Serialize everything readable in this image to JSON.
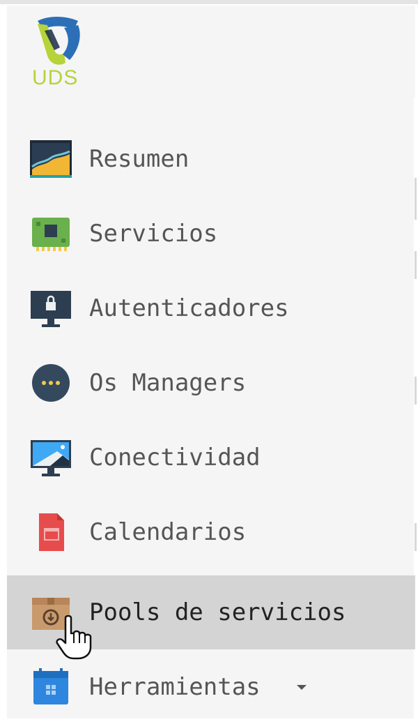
{
  "brand": {
    "logo_text": "UDS"
  },
  "menu": {
    "items": [
      {
        "label": "Resumen",
        "icon": "dashboard-chart-icon"
      },
      {
        "label": "Servicios",
        "icon": "circuit-board-icon"
      },
      {
        "label": "Autenticadores",
        "icon": "lock-monitor-icon"
      },
      {
        "label": "Os Managers",
        "icon": "more-dots-icon"
      },
      {
        "label": "Conectividad",
        "icon": "landscape-monitor-icon"
      },
      {
        "label": "Calendarios",
        "icon": "calendar-icon"
      },
      {
        "label": "Pools de servicios",
        "icon": "package-box-icon",
        "active": true
      },
      {
        "label": "Herramientas",
        "icon": "apps-grid-icon",
        "has_dropdown": true
      }
    ]
  },
  "colors": {
    "sidebar_bg": "#f5f5f5",
    "active_bg": "#d4d4d4",
    "label_text": "#555555",
    "logo_green": "#b6d33a",
    "logo_blue": "#2c6fb7"
  }
}
